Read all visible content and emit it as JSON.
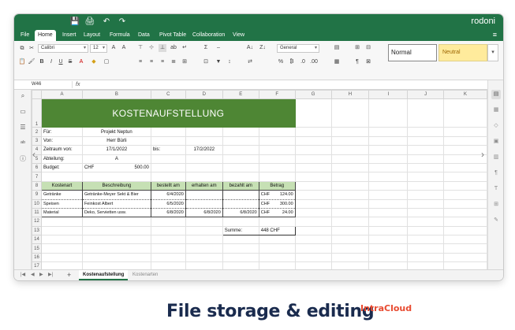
{
  "app": {
    "name": "rodoni",
    "quick_access": [
      "💾",
      "🖨",
      "↶",
      "↷"
    ]
  },
  "menu": {
    "tabs": [
      "File",
      "Home",
      "Insert",
      "Layout",
      "Formula",
      "Data",
      "Pivot Table",
      "Collaboration",
      "View"
    ],
    "active": "Home"
  },
  "ribbon": {
    "font_name": "Calibri",
    "font_size": "12",
    "number_format": "General",
    "styles": {
      "normal": "Normal",
      "neutral": "Neutral"
    }
  },
  "formula_bar": {
    "cell_ref": "W46",
    "fx": "fx",
    "content": ""
  },
  "grid": {
    "columns": [
      "A",
      "B",
      "C",
      "D",
      "E",
      "F",
      "G",
      "H",
      "I",
      "J",
      "K"
    ],
    "rows": [
      "1",
      "2",
      "3",
      "4",
      "5",
      "6",
      "7",
      "8",
      "9",
      "10",
      "11",
      "12",
      "13",
      "14",
      "15",
      "16",
      "17",
      "18",
      "19"
    ],
    "cells": {
      "title": "KOSTENAUFSTELLUNG",
      "a2": "Für:",
      "b2": "Projekt Neptun",
      "a3": "Von:",
      "b3": "Herr Bürli",
      "a4": "Zeitraum von:",
      "b4": "17/1/2022",
      "c4": "bis:",
      "d4": "17/2/2022",
      "a5": "Abteilung:",
      "b5": "A",
      "a6": "Budget:",
      "b6_cur": "CHF",
      "b6_val": "500.00",
      "headers": [
        "Kostenart",
        "Beschreibung",
        "bestellt am",
        "erhalten am",
        "bezahlt am",
        "Betrag"
      ],
      "items": [
        {
          "kostenart": "Getränke",
          "beschreibung": "Getränke-Meyer Sekt & Bier",
          "bestellt": "6/4/2020",
          "erhalten": "",
          "bezahlt": "",
          "cur": "CHF",
          "betrag": "124.00"
        },
        {
          "kostenart": "Speisen",
          "beschreibung": "Feinkost Albert",
          "bestellt": "6/5/2020",
          "erhalten": "",
          "bezahlt": "",
          "cur": "CHF",
          "betrag": "300.00"
        },
        {
          "kostenart": "Material",
          "beschreibung": "Deko, Servietten usw.",
          "bestellt": "6/8/2020",
          "erhalten": "6/8/2020",
          "bezahlt": "6/8/2020",
          "cur": "CHF",
          "betrag": "24.00"
        }
      ],
      "summe_label": "Summe:",
      "summe_value": "448 CHF"
    }
  },
  "sheets": {
    "tabs": [
      "Kostenaufstellung",
      "Kostenarten"
    ],
    "active": "Kostenaufstellung"
  },
  "footer": {
    "title": "File storage & editing",
    "brand": "IntraCloud"
  }
}
